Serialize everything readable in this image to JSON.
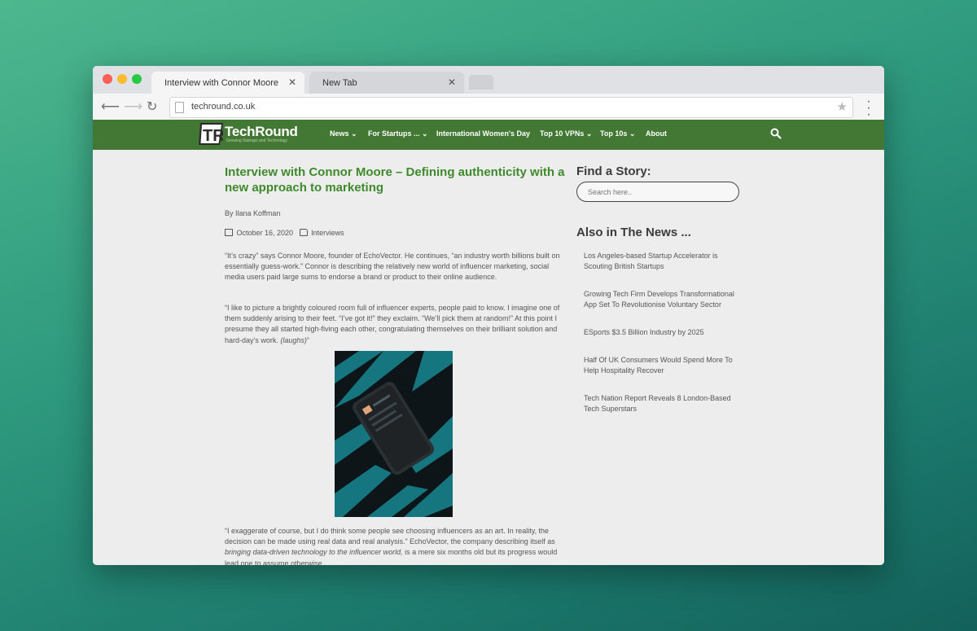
{
  "browser": {
    "tabs": [
      {
        "label": "Interview with Connor Moore",
        "close": "✕"
      },
      {
        "label": "New Tab",
        "close": "✕"
      }
    ],
    "url": "techround.co.uk"
  },
  "site": {
    "logo_mark": "TR",
    "logo_text": "TechRound",
    "logo_tagline": "Growing Startups and Technology",
    "brand_color": "#437834",
    "menu": [
      "News",
      "For Startups ...",
      "International Women's Day",
      "Top 10 VPNs",
      "Top 10s",
      "About"
    ],
    "menu_chevron": "⌄"
  },
  "article": {
    "title": "Interview with Connor Moore – Defining authenticity with a new approach to marketing",
    "byline": "By Ilana Koffman",
    "date": "October 16, 2020",
    "category": "Interviews",
    "p1": "“It’s crazy” says Connor Moore, founder of EchoVector. He continues, “an industry worth billions built on essentially guess-work.” Connor is describing the relatively new world of influencer marketing, social media users paid large sums to endorse a brand or product to their online audience.",
    "p2": "“I like to picture a brightly coloured room full of influencer experts, people paid to know. I imagine one of them suddenly arising to their feet. “I’ve got it!” they exclaim. “We’ll pick them at random!” At this point I presume they all started high-fiving each other, congratulating themselves on their brilliant solution and hard-day’s work.",
    "p2_italic": "(laughs)",
    "p2_end": "”",
    "p3_start": "“I exaggerate of course, but I do think some people see choosing influencers as an art. In reality, the decision can be made using real data and real analysis.” EchoVector, the company describing itself as",
    "p3_italic": "bringing data-driven technology to the influencer world,",
    "p3_end": "is a mere six months old but its progress would lead one to assume otherwise."
  },
  "sidebar": {
    "find_title": "Find a Story:",
    "search_placeholder": "Search here..",
    "news_title": "Also in The News ...",
    "news_items": [
      "Los Angeles-based Startup Accelerator is Scouting British Startups",
      "Growing Tech Firm Develops Transformational App Set To Revolutionise Voluntary Sector",
      "ESports $3.5 Billion Industry by 2025",
      "Half Of UK Consumers Would Spend More To Help Hospitality Recover",
      "Tech Nation Report Reveals 8 London-Based Tech Superstars"
    ]
  }
}
